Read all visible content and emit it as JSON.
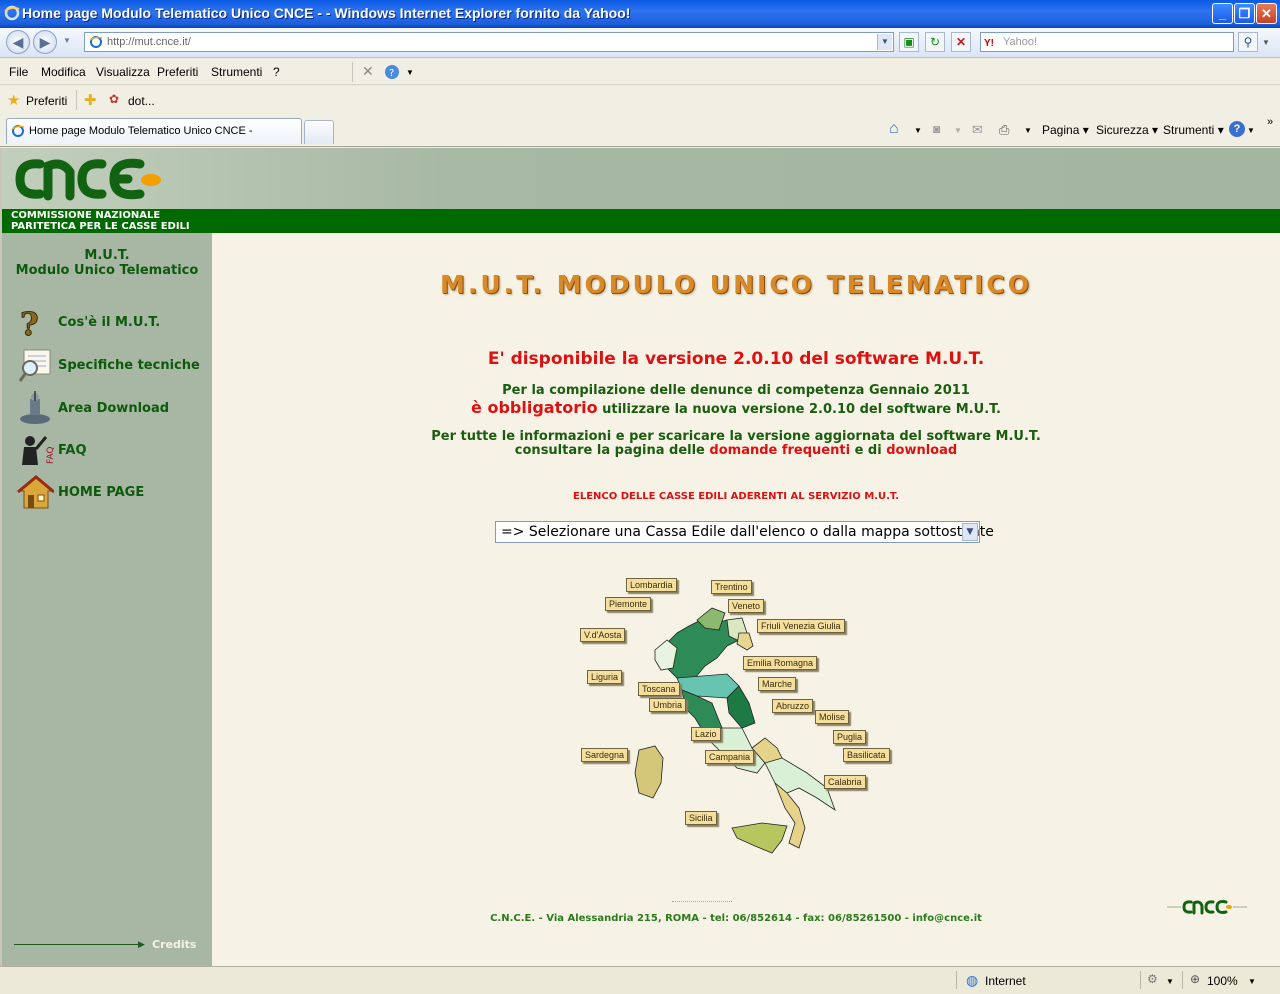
{
  "window": {
    "title": "Home page Modulo Telematico Unico CNCE - - Windows Internet Explorer fornito da Yahoo!",
    "minimize": "_",
    "maximize": "❐",
    "close": "✕"
  },
  "address_bar": {
    "url": "http://mut.cnce.it/",
    "search_placeholder": "Yahoo!"
  },
  "menu": [
    "File",
    "Modifica",
    "Visualizza",
    "Preferiti",
    "Strumenti",
    "?"
  ],
  "favorites_bar": {
    "favorites_label": "Preferiti",
    "link_label": "dot..."
  },
  "tabs": {
    "active_tab_label": "Home page Modulo Telematico Unico CNCE -"
  },
  "command_bar": {
    "pagina": "Pagina",
    "sicurezza": "Sicurezza",
    "strumenti": "Strumenti"
  },
  "site_header": {
    "org_line1": "COMMISSIONE NAZIONALE",
    "org_line2": "PARITETICA PER LE CASSE EDILI"
  },
  "sidebar": {
    "title_line1": "M.U.T.",
    "title_line2": "Modulo Unico Telematico",
    "items": [
      {
        "label": "Cos'è il M.U.T.",
        "icon": "question-icon"
      },
      {
        "label": "Specifiche tecniche",
        "icon": "document-magnifier-icon"
      },
      {
        "label": "Area Download",
        "icon": "download-icon"
      },
      {
        "label": "FAQ",
        "icon": "faq-icon"
      },
      {
        "label": "HOME PAGE",
        "icon": "home-icon"
      }
    ],
    "credits": "Credits"
  },
  "main": {
    "title": "M.U.T. MODULO UNICO TELEMATICO",
    "version_notice": "E' disponibile la versione 2.0.10 del software M.U.T.",
    "compile_line": "Per la compilazione delle denunce di competenza Gennaio 2011",
    "obbligatorio": "è obbligatorio",
    "obbligatorio_rest": " utilizzare la nuova versione 2.0.10 del software M.U.T.",
    "info_line": "Per tutte le informazioni e per scaricare la versione aggiornata del software M.U.T.",
    "consult_prefix": "consultare la pagina delle ",
    "faq_link": "domande frequenti",
    "consult_mid": " e di ",
    "download_link": "download",
    "casse_heading": "ELENCO DELLE CASSE EDILI ADERENTI AL SERVIZIO M.U.T.",
    "select_value": "=> Selezionare una Cassa Edile dall'elenco o dalla mappa sottostante"
  },
  "map": {
    "regions": [
      "Lombardia",
      "Trentino",
      "Piemonte",
      "Veneto",
      "V.d'Aosta",
      "Friuli Venezia Giulia",
      "Emilia Romagna",
      "Liguria",
      "Marche",
      "Toscana",
      "Umbria",
      "Abruzzo",
      "Molise",
      "Lazio",
      "Puglia",
      "Sardegna",
      "Campania",
      "Basilicata",
      "Calabria",
      "Sicilia"
    ]
  },
  "footer": {
    "address": "C.N.C.E. - Via Alessandria 215, ROMA - tel: 06/852614 - fax: 06/85261500 - info@cnce.it"
  },
  "status_bar": {
    "zone": "Internet",
    "zoom": "100%"
  },
  "colors": {
    "sidebar_bg": "#a8b7a4",
    "header_green": "#006a00",
    "content_bg": "#f6f3e6",
    "accent_red": "#dd1111",
    "text_green": "#1b5c0f"
  }
}
